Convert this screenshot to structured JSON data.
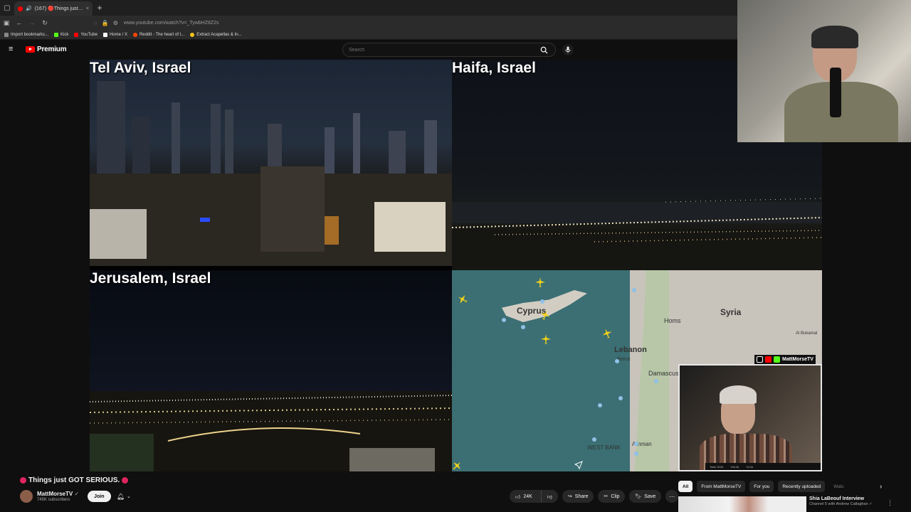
{
  "browser": {
    "tab": {
      "title": "(167) 🔴Things just GOT SE",
      "close": "×"
    },
    "new_tab": "+",
    "url": "www.youtube.com/watch?v=_TywbHZ8Z2s",
    "bookmarks": [
      {
        "label": "Import bookmarks...",
        "color": "#888888"
      },
      {
        "label": "Kick",
        "color": "#53fc18"
      },
      {
        "label": "YouTube",
        "color": "#ff0000"
      },
      {
        "label": "Home / X",
        "color": "#ffffff"
      },
      {
        "label": "Reddit - The heart of t...",
        "color": "#ff4500"
      },
      {
        "label": "Extract Acapellas & In...",
        "color": "#f5c518"
      }
    ]
  },
  "youtube": {
    "logo_text": "Premium",
    "search_placeholder": "Search"
  },
  "video": {
    "quadrants": {
      "top_left": "Tel Aviv, Israel",
      "top_right": "Haifa, Israel",
      "bottom_left": "Jerusalem, Israel"
    },
    "map_labels": {
      "cyprus": "Cyprus",
      "syria": "Syria",
      "homs": "Homs",
      "lebanon": "Lebanon",
      "beirut": "Beirut",
      "damascus": "Damascus",
      "west_bank": "WEST BANK",
      "amman": "Amman",
      "al_bukamal": "Al Bukamal"
    },
    "overlay_handle": "MattMorseTV",
    "inset_ticker": [
      "Total: 512k",
      "194.4k",
      "13.1k"
    ]
  },
  "video_title": "Things just GOT SERIOUS.",
  "channel": {
    "name": "MattMorseTV",
    "verified": "✓",
    "subscribers": "745K subscribers",
    "join_label": "Join"
  },
  "actions": {
    "likes": "24K",
    "share": "Share",
    "clip": "Clip",
    "save": "Save",
    "more": "⋯"
  },
  "chips": [
    "All",
    "From MattMorseTV",
    "For you",
    "Recently uploaded",
    "Watc"
  ],
  "recommendation": {
    "title": "Shia LaBeouf Interview",
    "channel": "Channel 5 with Andrew Callaghan ✓"
  },
  "colors": {
    "yt_red": "#ff0000",
    "page_bg": "#0f0f0f",
    "map_sea": "#3b6f73",
    "plane": "#f2d21b"
  }
}
